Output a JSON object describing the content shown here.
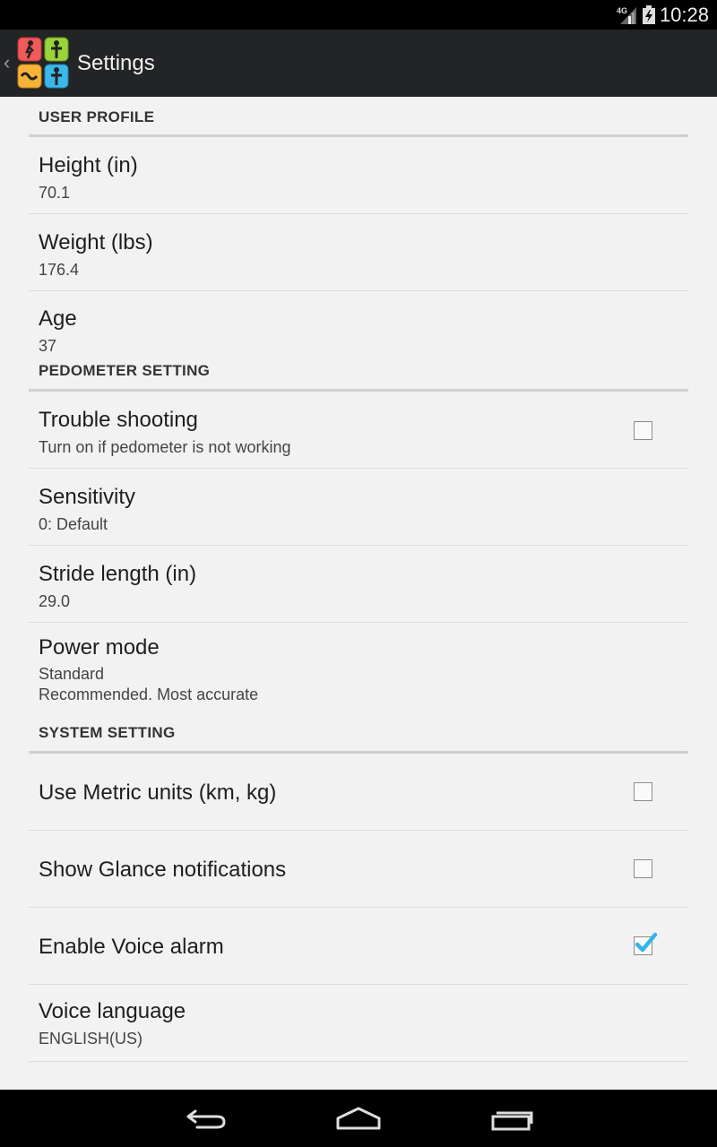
{
  "status_bar": {
    "time": "10:28",
    "network": "4G",
    "icons": [
      "signal-icon",
      "battery-icon"
    ]
  },
  "action_bar": {
    "title": "Settings",
    "app_icon": "pedometer-app-icon"
  },
  "sections": {
    "user_profile": {
      "header": "USER PROFILE",
      "height": {
        "title": "Height (in)",
        "summary": "70.1"
      },
      "weight": {
        "title": "Weight (lbs)",
        "summary": "176.4"
      },
      "age": {
        "title": "Age",
        "summary": "37"
      }
    },
    "pedometer": {
      "header": "PEDOMETER SETTING",
      "trouble": {
        "title": "Trouble shooting",
        "summary": "Turn on if pedometer is not working",
        "checked": false
      },
      "sensitivity": {
        "title": "Sensitivity",
        "summary": "0: Default"
      },
      "stride": {
        "title": "Stride length (in)",
        "summary": "29.0"
      },
      "power": {
        "title": "Power mode",
        "summary_line1": "Standard",
        "summary_line2": "Recommended. Most accurate"
      }
    },
    "system": {
      "header": "SYSTEM SETTING",
      "metric": {
        "title": "Use Metric units (km, kg)",
        "checked": false
      },
      "glance": {
        "title": "Show Glance notifications",
        "checked": false
      },
      "voice_alarm": {
        "title": "Enable Voice alarm",
        "checked": true
      },
      "voice_language": {
        "title": "Voice language",
        "summary": "ENGLISH(US)"
      }
    }
  },
  "colors": {
    "check_accent": "#33b5e5",
    "action_bar_bg": "#222426",
    "background": "#f2f2f2"
  },
  "nav_bar": {
    "buttons": [
      "back-icon",
      "home-icon",
      "recents-icon"
    ]
  }
}
